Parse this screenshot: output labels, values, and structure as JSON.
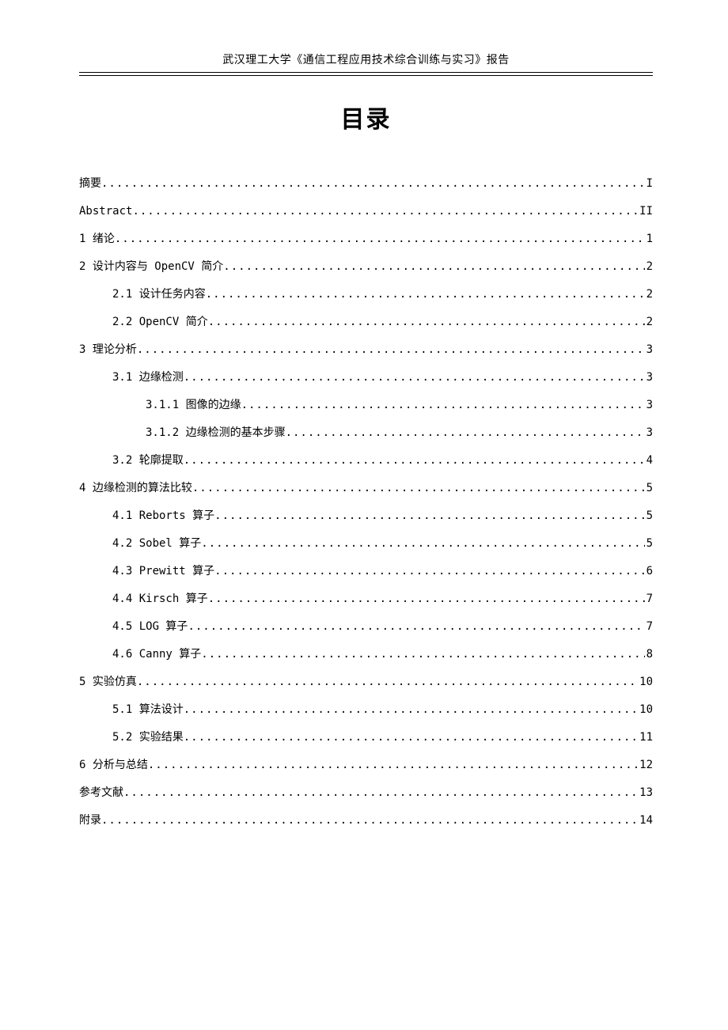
{
  "header": "武汉理工大学《通信工程应用技术综合训练与实习》报告",
  "title": "目录",
  "toc": [
    {
      "level": 1,
      "label": "摘要",
      "page": "I"
    },
    {
      "level": 1,
      "label": "Abstract",
      "page": "II"
    },
    {
      "level": 1,
      "label": "1 绪论",
      "page": "1"
    },
    {
      "level": 1,
      "label": "2 设计内容与 OpenCV 简介",
      "page": "2"
    },
    {
      "level": 2,
      "label": "2.1 设计任务内容 ",
      "page": "2"
    },
    {
      "level": 2,
      "label": "2.2 OpenCV 简介",
      "page": "2"
    },
    {
      "level": 1,
      "label": "3 理论分析",
      "page": "3"
    },
    {
      "level": 2,
      "label": "3.1 边缘检测 ",
      "page": "3"
    },
    {
      "level": 3,
      "label": "3.1.1 图像的边缘 ",
      "page": "3"
    },
    {
      "level": 3,
      "label": "3.1.2 边缘检测的基本步骤 ",
      "page": "3"
    },
    {
      "level": 2,
      "label": "3.2 轮廓提取 ",
      "page": "4"
    },
    {
      "level": 1,
      "label": "4 边缘检测的算法比较",
      "page": "5"
    },
    {
      "level": 2,
      "label": "4.1 Reborts 算子",
      "page": "5"
    },
    {
      "level": 2,
      "label": "4.2 Sobel 算子",
      "page": "5"
    },
    {
      "level": 2,
      "label": "4.3 Prewitt 算子 ",
      "page": "6"
    },
    {
      "level": 2,
      "label": "4.4 Kirsch 算子 ",
      "page": "7"
    },
    {
      "level": 2,
      "label": "4.5 LOG 算子",
      "page": "7"
    },
    {
      "level": 2,
      "label": "4.6 Canny 算子",
      "page": "8"
    },
    {
      "level": 1,
      "label": "5 实验仿真",
      "page": "10"
    },
    {
      "level": 2,
      "label": "5.1 算法设计",
      "page": "10"
    },
    {
      "level": 2,
      "label": "5.2 实验结果 ",
      "page": "11"
    },
    {
      "level": 1,
      "label": "6 分析与总结",
      "page": "12"
    },
    {
      "level": 1,
      "label": "参考文献",
      "page": "13"
    },
    {
      "level": 1,
      "label": "附录",
      "page": "14"
    }
  ]
}
